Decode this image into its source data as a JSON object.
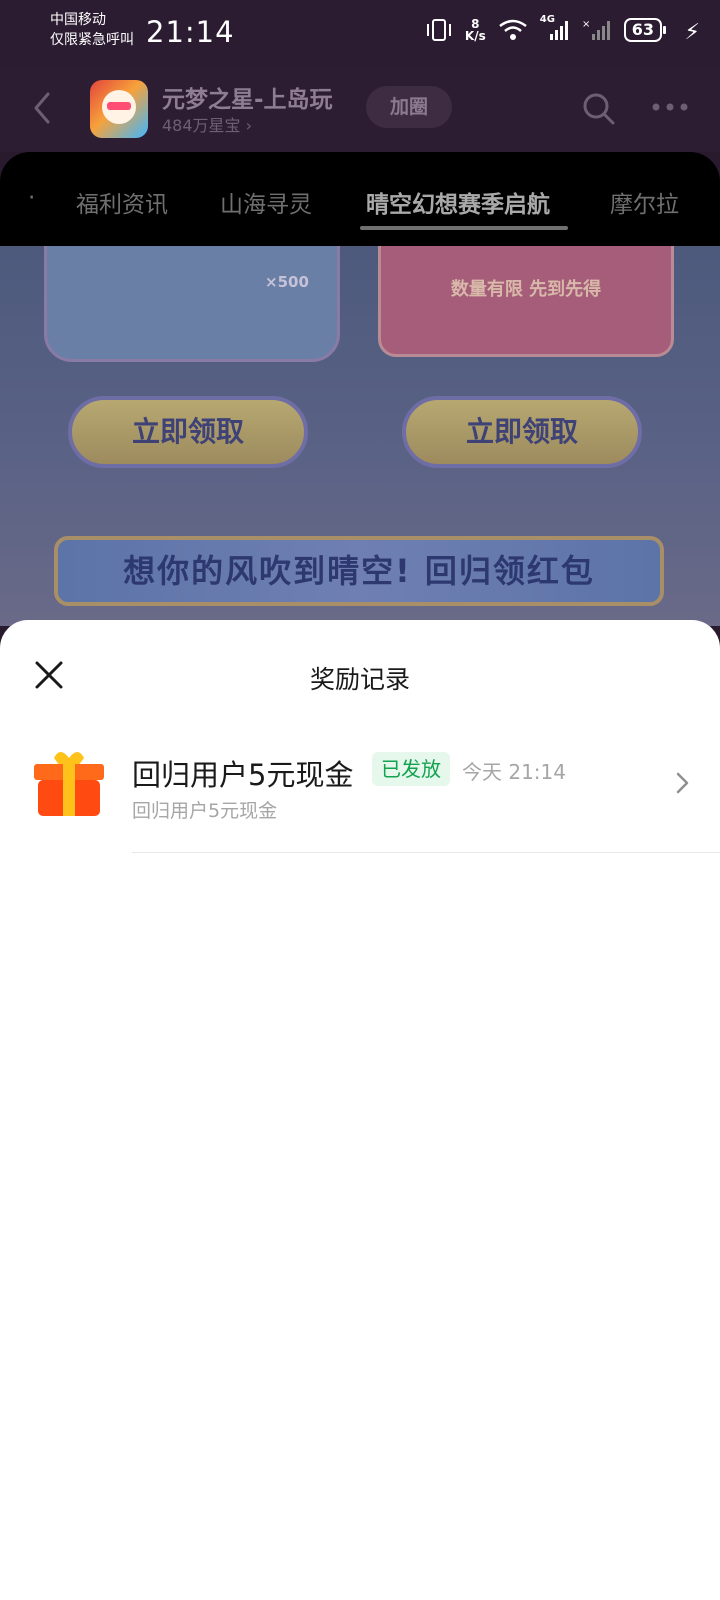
{
  "status_bar": {
    "carrier_line1": "中国移动",
    "carrier_line2": "仅限紧急呼叫",
    "time": "21:14",
    "net_speed_value": "8",
    "net_speed_unit": "K/s",
    "network_label": "4G",
    "battery": "63"
  },
  "header": {
    "title": "元梦之星-上岛玩",
    "subtitle": "484万星宝",
    "join_label": "加圈"
  },
  "tabs": {
    "leading_dot": "·",
    "items": [
      {
        "label": "福利资讯"
      },
      {
        "label": "山海寻灵"
      },
      {
        "label": "晴空幻想赛季启航"
      },
      {
        "label": "摩尔拉"
      }
    ],
    "active_index": 2
  },
  "banner": {
    "left_count": "×500",
    "right_hint": "数量有限 先到先得",
    "claim_left": "立即领取",
    "claim_right": "立即领取",
    "ribbon_text": "想你的风吹到晴空! 回归领红包"
  },
  "sheet": {
    "title": "奖励记录",
    "records": [
      {
        "title": "回归用户5元现金",
        "badge": "已发放",
        "time": "今天 21:14",
        "subtitle": "回归用户5元现金"
      }
    ]
  },
  "colors": {
    "badge_text": "#13a350",
    "badge_bg": "#e6f7ec",
    "sheet_bg": "#ffffff",
    "header_bg": "#2d1d33"
  },
  "icons": {
    "back": "chevron-left-icon",
    "search": "search-icon",
    "more": "more-horizontal-icon",
    "close": "close-icon",
    "gift": "gift-icon",
    "record_arrow": "chevron-right-icon"
  }
}
